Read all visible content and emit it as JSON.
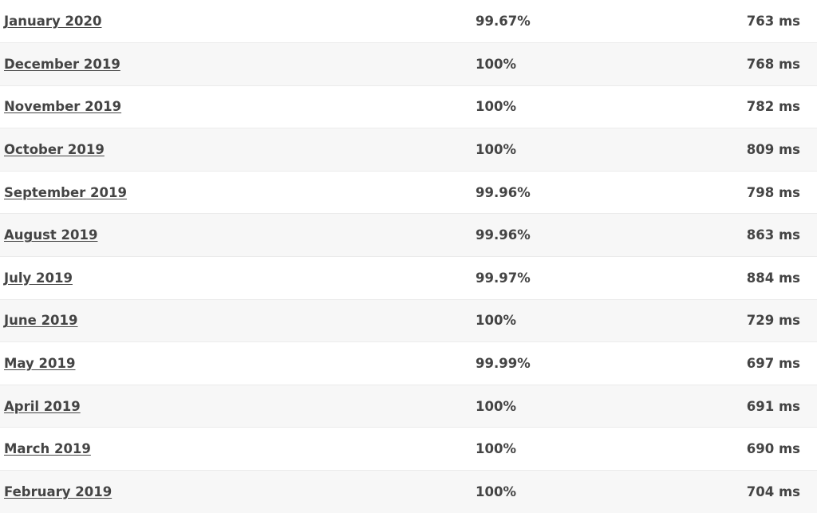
{
  "rows": [
    {
      "month": "January 2020",
      "uptime": "99.67%",
      "response": "763 ms"
    },
    {
      "month": "December 2019",
      "uptime": "100%",
      "response": "768 ms"
    },
    {
      "month": "November 2019",
      "uptime": "100%",
      "response": "782 ms"
    },
    {
      "month": "October 2019",
      "uptime": "100%",
      "response": "809 ms"
    },
    {
      "month": "September 2019",
      "uptime": "99.96%",
      "response": "798 ms"
    },
    {
      "month": "August 2019",
      "uptime": "99.96%",
      "response": "863 ms"
    },
    {
      "month": "July 2019",
      "uptime": "99.97%",
      "response": "884 ms"
    },
    {
      "month": "June 2019",
      "uptime": "100%",
      "response": "729 ms"
    },
    {
      "month": "May 2019",
      "uptime": "99.99%",
      "response": "697 ms"
    },
    {
      "month": "April 2019",
      "uptime": "100%",
      "response": "691 ms"
    },
    {
      "month": "March 2019",
      "uptime": "100%",
      "response": "690 ms"
    },
    {
      "month": "February 2019",
      "uptime": "100%",
      "response": "704 ms"
    }
  ]
}
